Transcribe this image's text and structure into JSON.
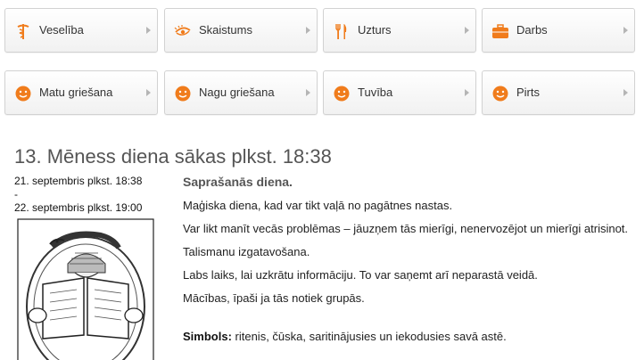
{
  "categories": {
    "row1": [
      {
        "label": "Veselība",
        "icon": "caduceus-icon"
      },
      {
        "label": "Skaistums",
        "icon": "eye-icon"
      },
      {
        "label": "Uzturs",
        "icon": "fork-knife-icon"
      },
      {
        "label": "Darbs",
        "icon": "briefcase-icon"
      }
    ],
    "row2": [
      {
        "label": "Matu griešana",
        "icon": "smiley-icon"
      },
      {
        "label": "Nagu griešana",
        "icon": "smiley-icon"
      },
      {
        "label": "Tuvība",
        "icon": "smiley-icon"
      },
      {
        "label": "Pirts",
        "icon": "smiley-icon"
      }
    ]
  },
  "moon_day": {
    "heading": "13. Mēness diena sākas plkst. 18:38",
    "start": "21. septembris plkst. 18:38",
    "separator": "-",
    "end": "22. septembris plkst. 19:00",
    "illustration": "snake-and-book-illustration"
  },
  "content": {
    "title": "Saprašanās diena.",
    "paragraphs": [
      "Maģiska diena, kad var tikt vaļā no pagātnes nastas.",
      "Var likt manīt vecās problēmas – jāuzņem tās mierīgi, nenervozējot un mierīgi atrisinot.",
      "Talismanu izgatavošana.",
      "Labs laiks, lai uzkrātu informāciju. To var saņemt arī neparastā veidā.",
      "Mācības, īpaši ja tās notiek grupās."
    ],
    "symbol_label": "Simbols:",
    "symbol_text": " ritenis, čūska, saritinājusies un iekodusies savā astē."
  },
  "colors": {
    "accent": "#f07c1c",
    "tile_border": "#d2d2d2",
    "heading": "#555555"
  }
}
